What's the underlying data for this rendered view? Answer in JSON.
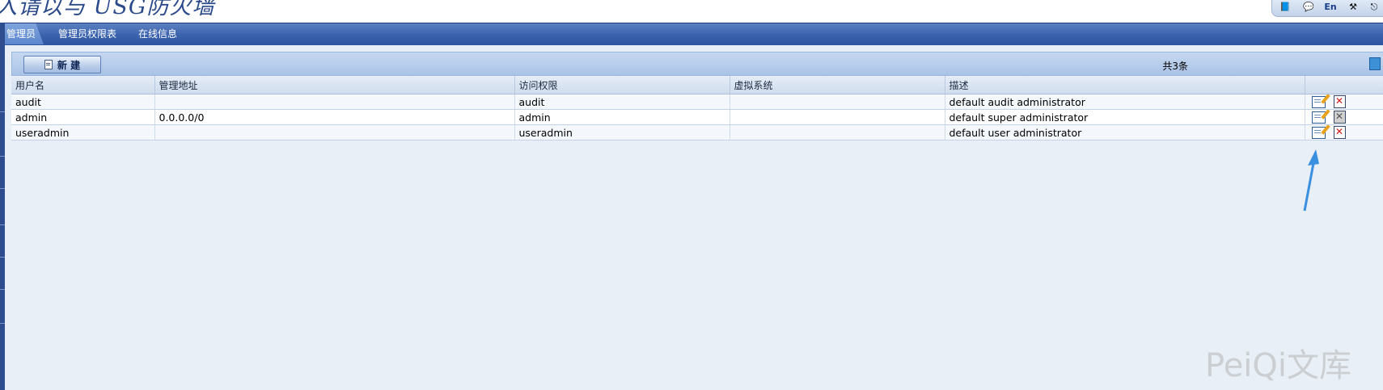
{
  "header": {
    "brand": "入请以与 USG防火墙",
    "tools": [
      "help-book-icon",
      "message-icon",
      "language-en-icon",
      "tools-icon",
      "logout-icon"
    ]
  },
  "tabs": [
    {
      "label": "管理员",
      "active": true
    },
    {
      "label": "管理员权限表",
      "active": false
    },
    {
      "label": "在线信息",
      "active": false
    }
  ],
  "toolbar": {
    "new_label": "新 建",
    "total": "共3条"
  },
  "table": {
    "columns": [
      "用户名",
      "管理地址",
      "访问权限",
      "虚拟系统",
      "描述",
      ""
    ],
    "rows": [
      {
        "username": "audit",
        "address": "",
        "access": "audit",
        "vsys": "",
        "desc": "default audit administrator",
        "delete_enabled": true
      },
      {
        "username": "admin",
        "address": "0.0.0.0/0",
        "access": "admin",
        "vsys": "",
        "desc": "default super administrator",
        "delete_enabled": false
      },
      {
        "username": "useradmin",
        "address": "",
        "access": "useradmin",
        "vsys": "",
        "desc": "default user administrator",
        "delete_enabled": true
      }
    ]
  },
  "watermark": "PeiQi文库",
  "colors": {
    "tab_bar": "#3a62ad",
    "content_bg": "#e9eff7",
    "annotation_arrow": "#3b8fe0",
    "delete_red": "#d31414"
  }
}
